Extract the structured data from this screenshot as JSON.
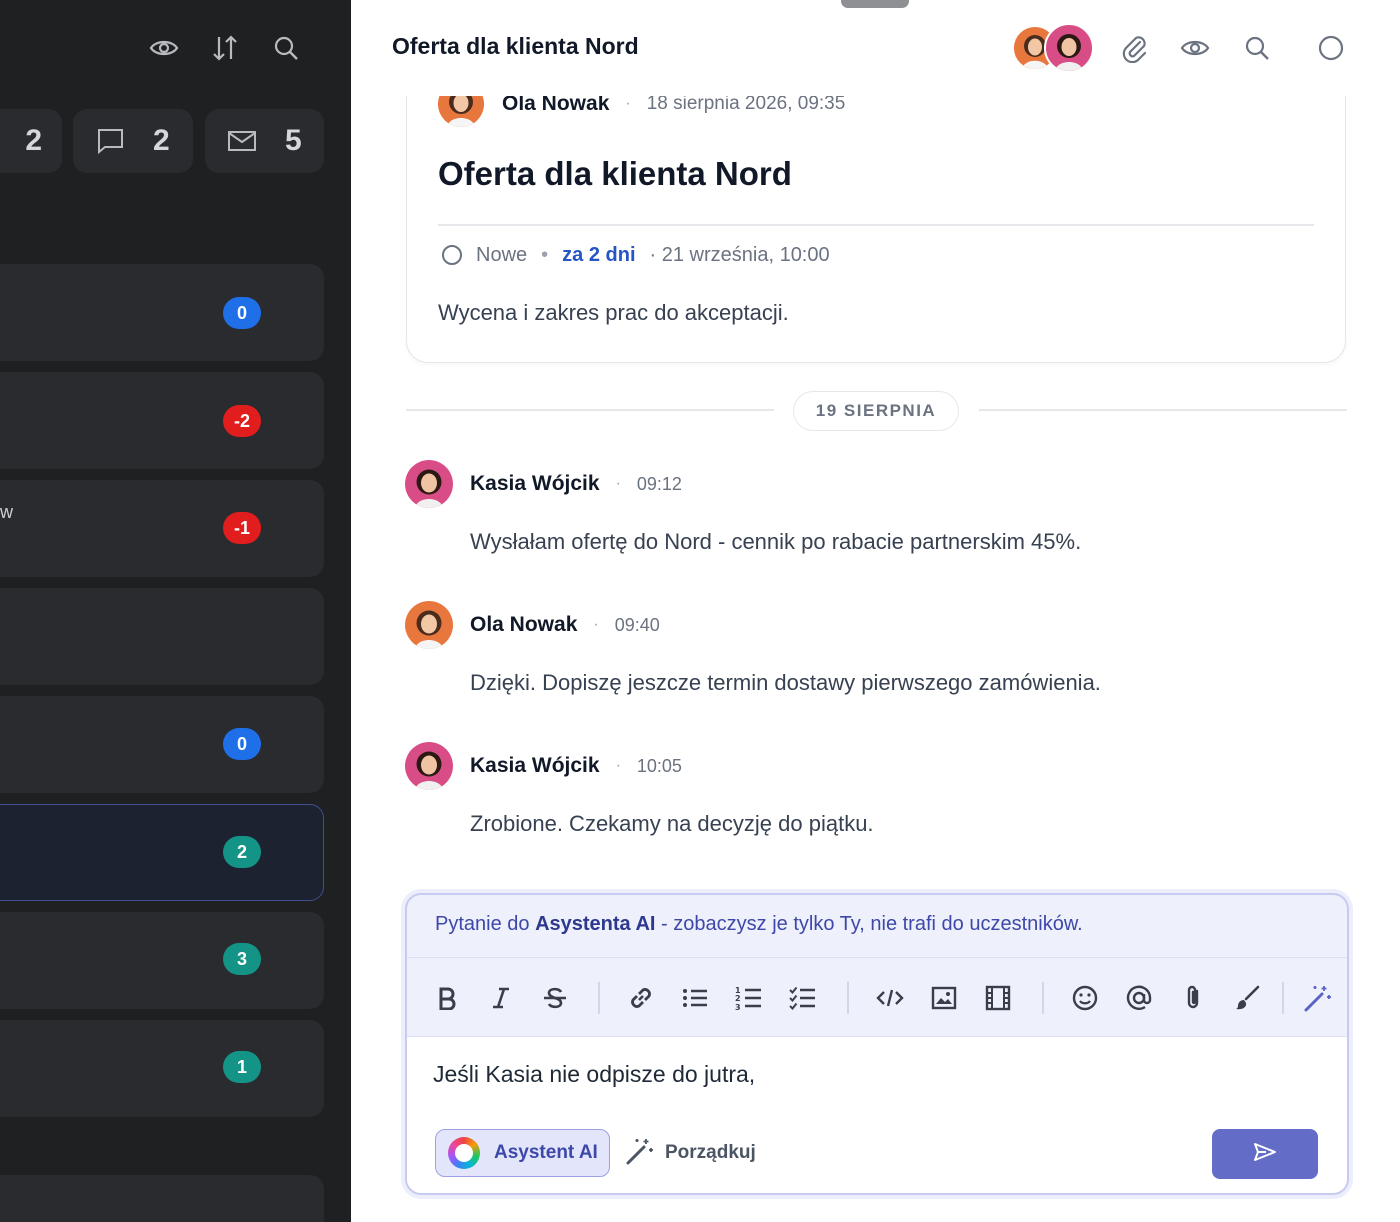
{
  "left_panel": {
    "stats": [
      {
        "name": "stat-tasks",
        "value": "2"
      },
      {
        "name": "stat-comments",
        "value": "2"
      },
      {
        "name": "stat-mail",
        "value": "5"
      }
    ],
    "cards": [
      {
        "badge": "0",
        "color": "#1e6fe8",
        "text": ""
      },
      {
        "badge": "-2",
        "color": "#e11d1d",
        "text": ""
      },
      {
        "badge": "-1",
        "color": "#e11d1d",
        "text": "w"
      },
      {
        "badge": "",
        "color": "",
        "text": ""
      },
      {
        "badge": "0",
        "color": "#1e6fe8",
        "text": ""
      },
      {
        "badge": "2",
        "color": "#139486",
        "text": ""
      },
      {
        "badge": "3",
        "color": "#139486",
        "text": ""
      },
      {
        "badge": "1",
        "color": "#139486",
        "text": ""
      }
    ]
  },
  "header": {
    "title": "Oferta dla klienta Nord"
  },
  "task": {
    "author": "Ola Nowak",
    "date": "18 sierpnia 2026, 09:35",
    "title": "Oferta dla klienta Nord",
    "status": "Nowe",
    "due_relative": "za 2 dni",
    "due_date": "· 21 września, 10:00",
    "description": "Wycena i zakres prac do akceptacji."
  },
  "date_separator": "19 SIERPNIA",
  "messages": [
    {
      "author": "Kasia Wójcik",
      "time": "09:12",
      "text": "Wysłałam ofertę do Nord - cennik po rabacie partnerskim 45%.",
      "avatar": "kasia"
    },
    {
      "author": "Ola Nowak",
      "time": "09:40",
      "text": "Dzięki. Dopiszę jeszcze termin dostawy pierwszego zamówienia.",
      "avatar": "ola"
    },
    {
      "author": "Kasia Wójcik",
      "time": "10:05",
      "text": "Zrobione. Czekamy na decyzję do piątku.",
      "avatar": "kasia"
    }
  ],
  "composer": {
    "note_prefix": "Pytanie do ",
    "note_bold": "Asystenta AI",
    "note_suffix": " - zobaczysz je tylko Ty, nie trafi do uczestników.",
    "draft": "Jeśli Kasia nie odpisze do jutra,",
    "ai_button": "Asystent AI",
    "tidy_button": "Porządkuj"
  },
  "colors": {
    "accent": "#636cc7",
    "link": "#2456c7",
    "ola_avatar": "#e8773e",
    "kasia_avatar": "#d94d86"
  }
}
